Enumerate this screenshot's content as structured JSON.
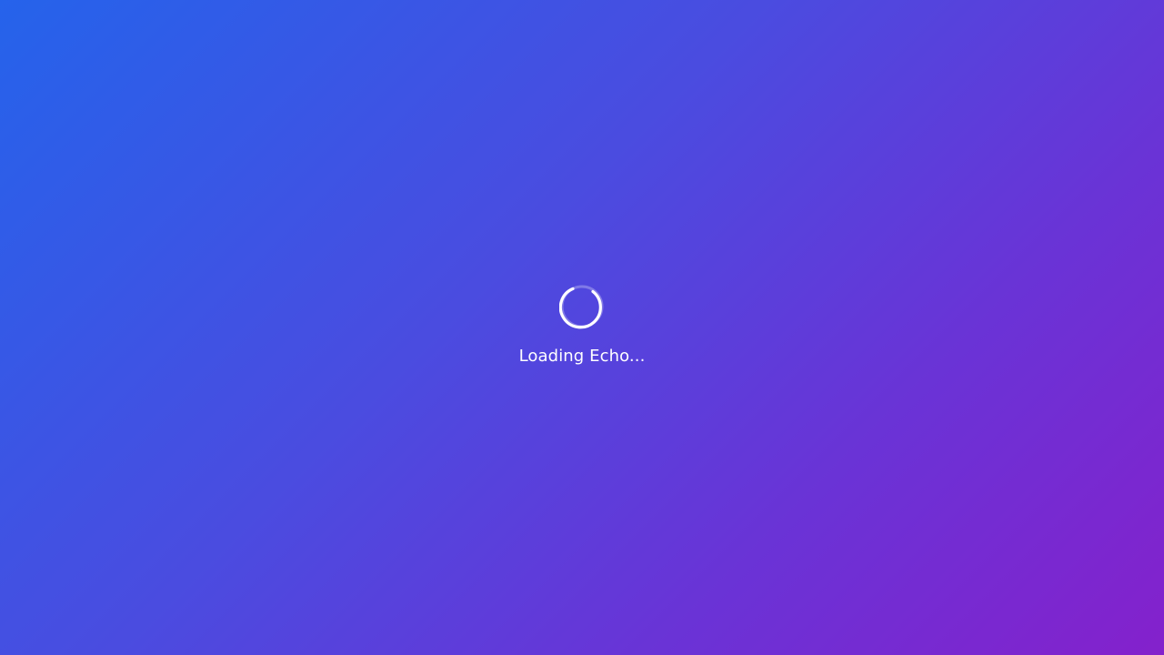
{
  "loading_screen": {
    "message": "Loading Echo...",
    "spinner_icon": "loading-spinner-icon",
    "colors": {
      "gradient_start": "#2563eb",
      "gradient_mid": "#4a4ce0",
      "gradient_end": "#8421cc",
      "text": "#ffffff"
    }
  }
}
